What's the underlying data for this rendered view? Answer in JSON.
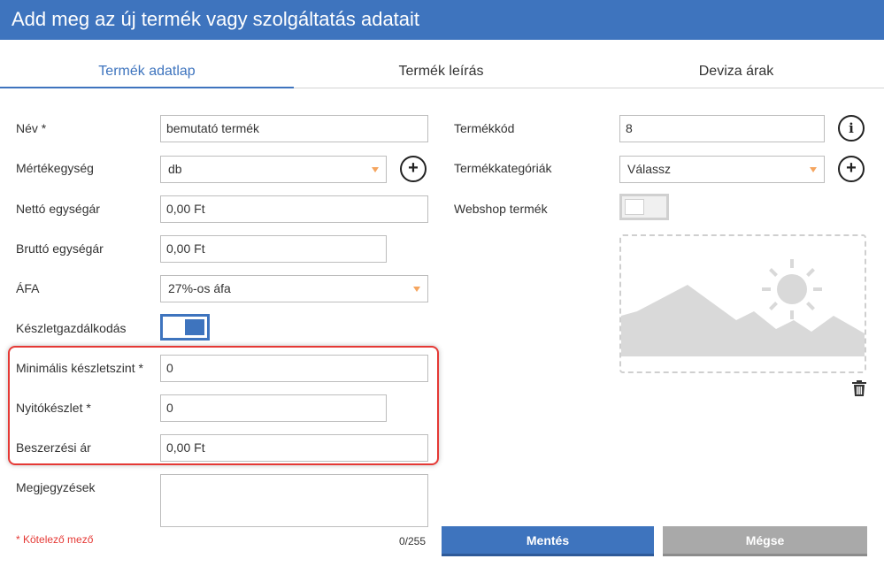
{
  "header": {
    "title": "Add meg az új termék vagy szolgáltatás adatait"
  },
  "tabs": [
    {
      "label": "Termék adatlap",
      "active": true
    },
    {
      "label": "Termék leírás",
      "active": false
    },
    {
      "label": "Deviza árak",
      "active": false
    }
  ],
  "form": {
    "name_label": "Név *",
    "name_value": "bemutató termék",
    "unit_label": "Mértékegység",
    "unit_value": "db",
    "net_price_label": "Nettó egységár",
    "net_price_value": "0,00 Ft",
    "gross_price_label": "Bruttó egységár",
    "gross_price_value": "0,00 Ft",
    "vat_label": "ÁFA",
    "vat_value": "27%-os áfa",
    "inventory_label": "Készletgazdálkodás",
    "inventory_enabled": true,
    "min_stock_label": "Minimális készletszint *",
    "min_stock_value": "0",
    "opening_stock_label": "Nyitókészlet *",
    "opening_stock_value": "0",
    "purchase_price_label": "Beszerzési ár",
    "purchase_price_value": "0,00 Ft",
    "notes_label": "Megjegyzések",
    "notes_value": "",
    "notes_counter": "0/255",
    "product_code_label": "Termékkód",
    "product_code_value": "8",
    "categories_label": "Termékkategóriák",
    "categories_value": "Válassz",
    "webshop_label": "Webshop termék",
    "webshop_enabled": false
  },
  "footer": {
    "required_note": "* Kötelező mező",
    "save_label": "Mentés",
    "cancel_label": "Mégse"
  },
  "icons": {
    "add": "plus-circle-icon",
    "info": "info-circle-icon",
    "caret": "chevron-down-icon",
    "image": "image-placeholder-icon",
    "delete": "trash-icon"
  },
  "colors": {
    "brand": "#3e74be",
    "caret": "#f5a55f",
    "highlight": "#e53935",
    "cancel": "#a9a9a9"
  }
}
